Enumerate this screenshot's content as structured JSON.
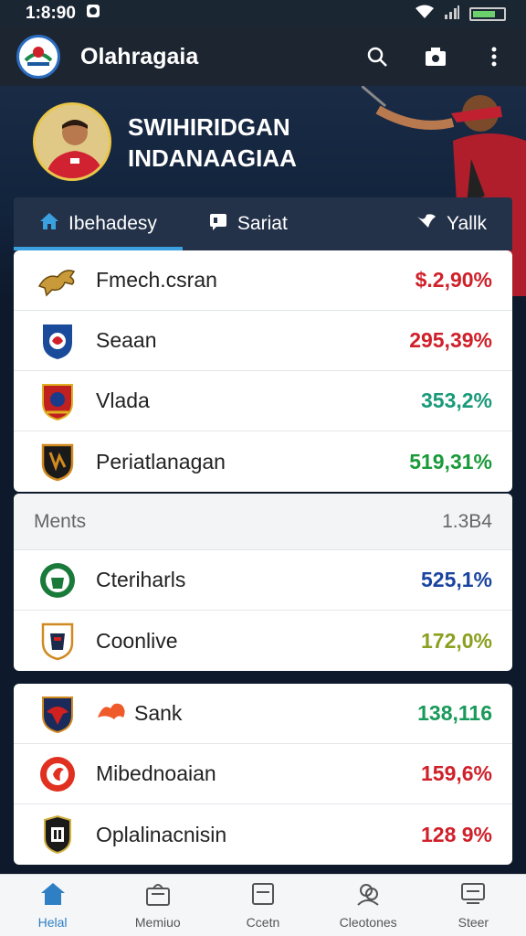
{
  "status_bar": {
    "time": "1:8:90"
  },
  "app_bar": {
    "title": "Olahragaia"
  },
  "hero": {
    "name_line1": "SWIHIRIDGAN",
    "name_line2": "INDANAAGIAA"
  },
  "tabs": [
    {
      "label": "Ibehadesy",
      "icon": "home-icon"
    },
    {
      "label": "Sariat",
      "icon": "chat-icon"
    },
    {
      "label": "Yallk",
      "icon": "bird-icon"
    }
  ],
  "list1": [
    {
      "label": "Fmech.csran",
      "value": "$.2,90%",
      "color": "#d0202a",
      "icon": "lion-crest-icon"
    },
    {
      "label": "Seaan",
      "value": "295,39%",
      "color": "#d0202a",
      "icon": "shield-crest-icon"
    },
    {
      "label": "Vlada",
      "value": "353,2%",
      "color": "#1a9a7a",
      "icon": "red-crest-icon"
    },
    {
      "label": "Periatlanagan",
      "value": "519,31%",
      "color": "#1a9a3a",
      "icon": "black-crest-icon"
    }
  ],
  "section2": {
    "title": "Ments",
    "count": "1.3B4"
  },
  "list2": [
    {
      "label": "Cteriharls",
      "value": "525,1%",
      "color": "#1a44a0",
      "icon": "green-crest-icon"
    },
    {
      "label": "Coonlive",
      "value": "172,0%",
      "color": "#8aa020",
      "icon": "knight-crest-icon"
    }
  ],
  "list3": [
    {
      "label": "Sank",
      "value": "138,116",
      "color": "#1a9a5a",
      "icon": "eagle-crest-icon"
    },
    {
      "label": "Mibednoaian",
      "value": "159,6%",
      "color": "#d0202a",
      "icon": "red-circle-crest-icon"
    },
    {
      "label": "Oplalinacnisin",
      "value": "128 9%",
      "color": "#d0202a",
      "icon": "tower-crest-icon"
    }
  ],
  "bottom_nav": [
    {
      "label": "Helal",
      "icon": "home-icon"
    },
    {
      "label": "Memiuo",
      "icon": "bag-icon"
    },
    {
      "label": "Ccetn",
      "icon": "card-icon"
    },
    {
      "label": "Cleotones",
      "icon": "people-icon"
    },
    {
      "label": "Steer",
      "icon": "monitor-icon"
    }
  ]
}
